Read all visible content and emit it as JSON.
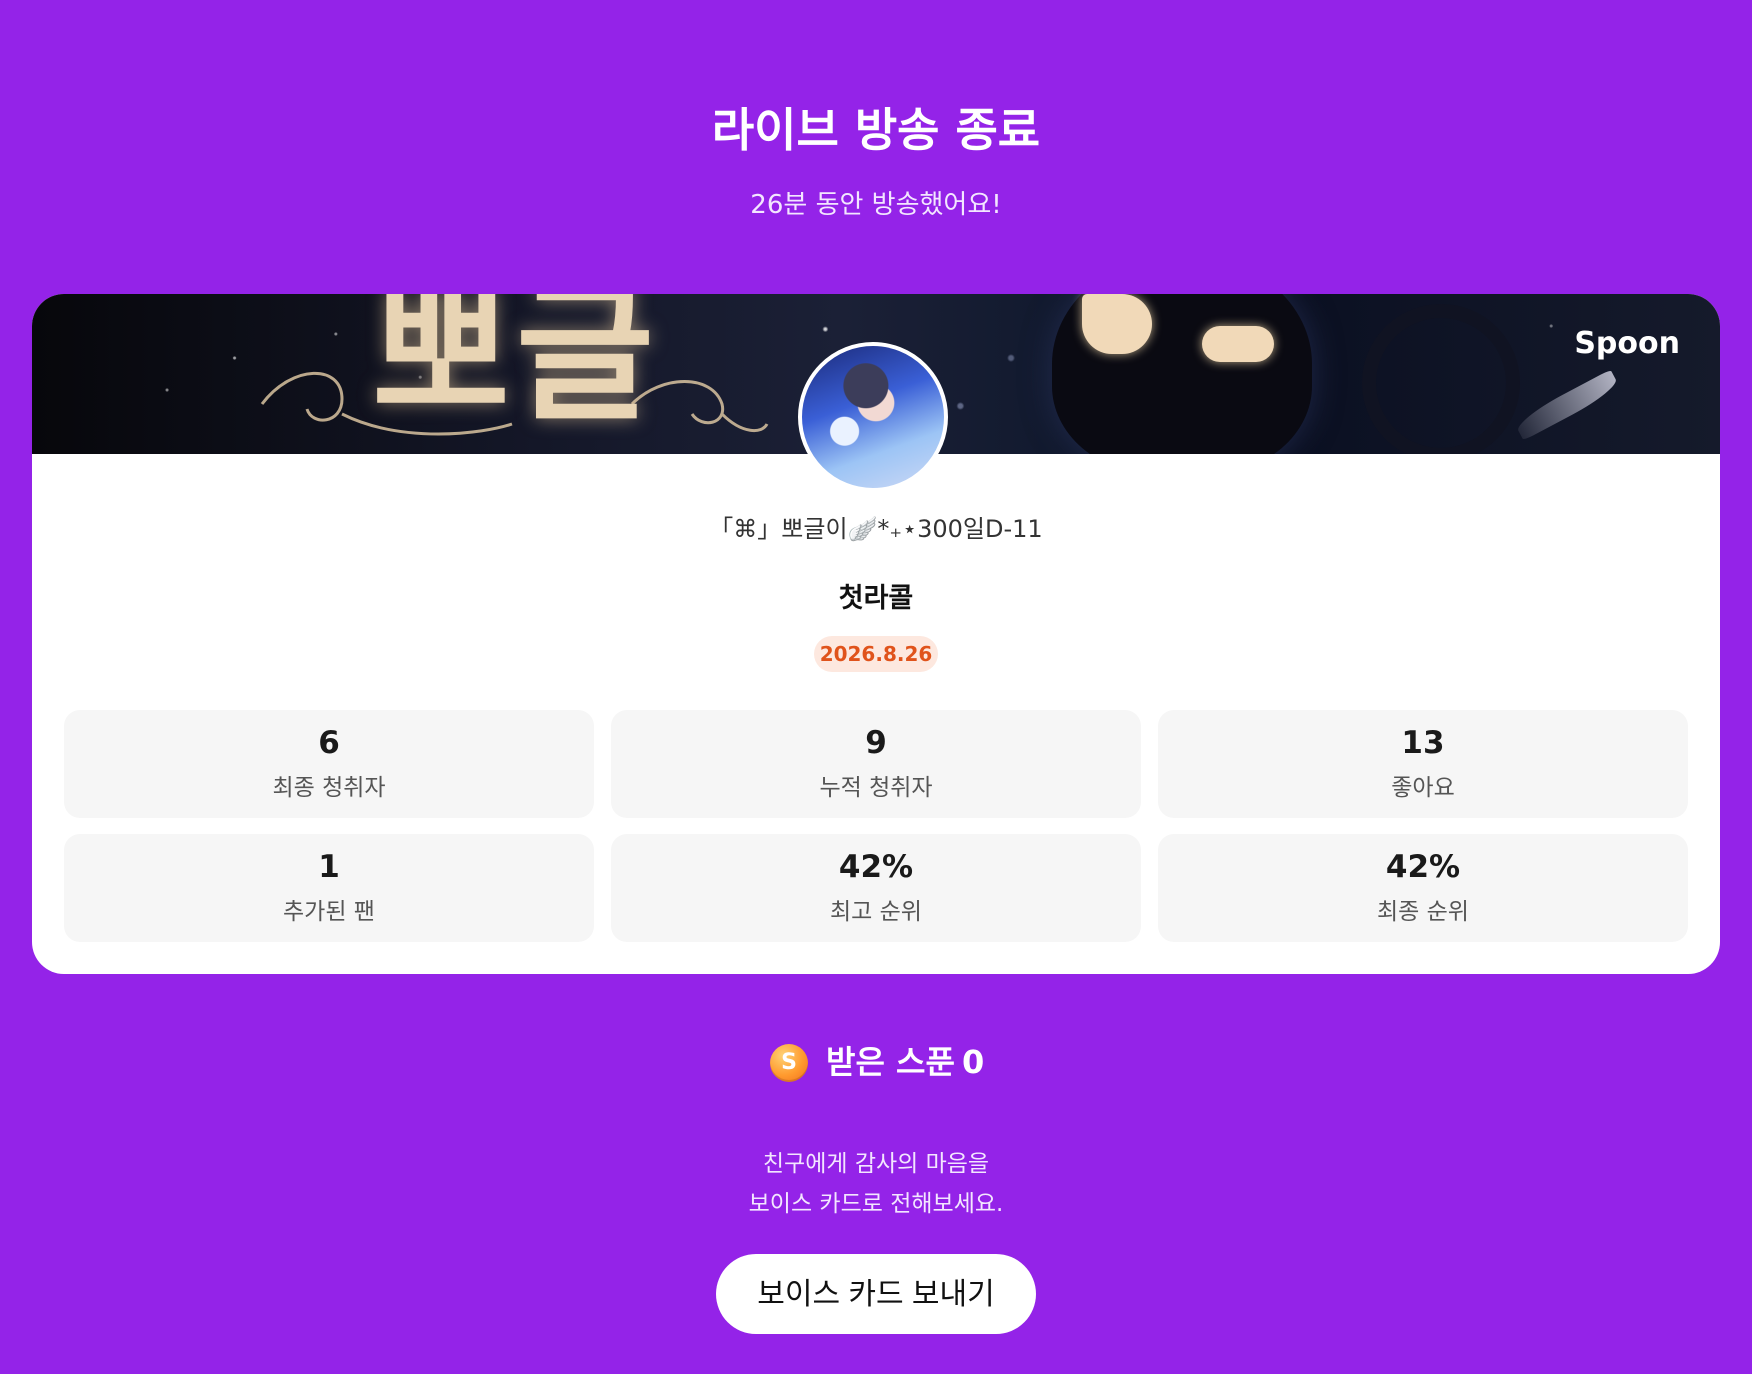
{
  "header": {
    "title": "라이브 방송 종료",
    "subtitle": "26분 동안 방송했어요!"
  },
  "card": {
    "banner_text": "뽀글",
    "brand": "Spoon",
    "dj_name": "「⌘」뽀글이🪽*₊⋆300일D-11",
    "show_title": "첫라콜",
    "date": "2026.8.26",
    "stats": [
      {
        "value": "6",
        "label": "최종 청취자"
      },
      {
        "value": "9",
        "label": "누적 청취자"
      },
      {
        "value": "13",
        "label": "좋아요"
      },
      {
        "value": "1",
        "label": "추가된 팬"
      },
      {
        "value": "42%",
        "label": "최고 순위"
      },
      {
        "value": "42%",
        "label": "최종 순위"
      }
    ]
  },
  "spoons": {
    "coin_symbol": "S",
    "label": "받은 스푼",
    "count": "0"
  },
  "thanks": {
    "line1": "친구에게 감사의 마음을",
    "line2": "보이스 카드로 전해보세요."
  },
  "voice_card_button": "보이스 카드 보내기",
  "colors": {
    "background": "#9423e8",
    "date_badge_text": "#e0531b",
    "date_badge_bg": "#fde8df",
    "coin": "#ff9a2e"
  }
}
